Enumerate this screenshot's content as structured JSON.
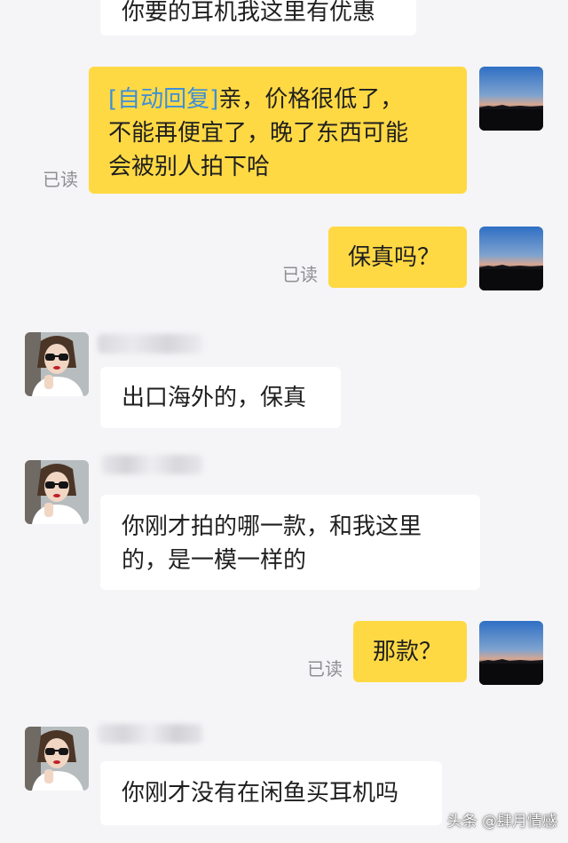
{
  "colors": {
    "background": "#f5f5f7",
    "incoming_bubble": "#ffffff",
    "outgoing_bubble": "#ffd944",
    "auto_reply_tag": "#3e8fd8",
    "read_status": "#8e8e93"
  },
  "messages": [
    {
      "direction": "incoming",
      "text": "你要的耳机我这里有优惠"
    },
    {
      "direction": "outgoing",
      "tag": "[自动回复]",
      "line1": "亲，价格很低了，",
      "line2": "不能再便宜了，晚了东西可能",
      "line3": "会被别人拍下哈",
      "status": "已读"
    },
    {
      "direction": "outgoing",
      "text": "保真吗？",
      "status": "已读"
    },
    {
      "direction": "incoming",
      "text": "出口海外的，保真"
    },
    {
      "direction": "incoming",
      "line1": "你刚才拍的哪一款，和我这里",
      "line2": "的，是一模一样的"
    },
    {
      "direction": "outgoing",
      "text": "那款？",
      "status": "已读"
    },
    {
      "direction": "incoming",
      "text": "你刚才没有在闲鱼买耳机吗"
    }
  ],
  "avatars": {
    "self": "sunset-landscape-photo",
    "contact": "woman-with-sunglasses-photo"
  },
  "watermark": "头条 @肆月情感"
}
